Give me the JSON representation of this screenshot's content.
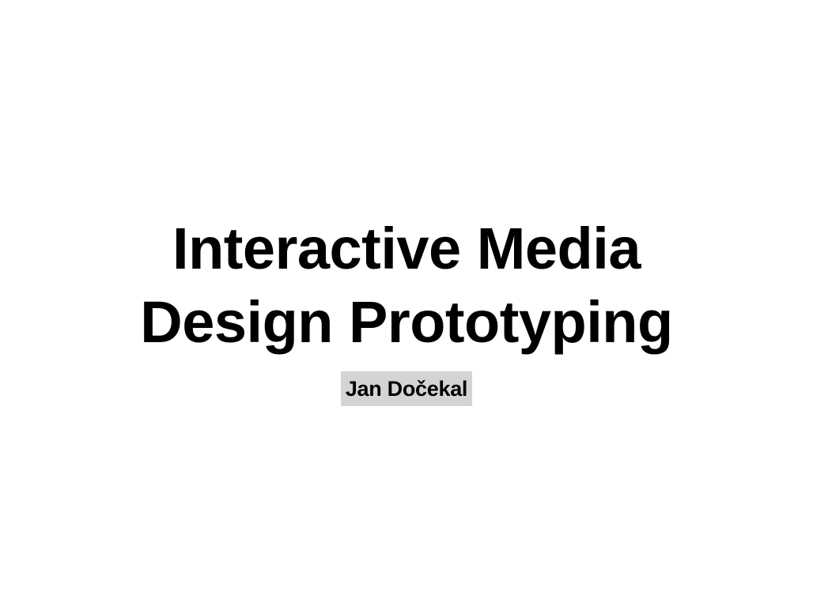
{
  "slide": {
    "title_line_1": "Interactive Media",
    "title_line_2": "Design Prototyping",
    "author": "Jan Dočekal",
    "author_highlight_color": "#d4d4d4"
  }
}
